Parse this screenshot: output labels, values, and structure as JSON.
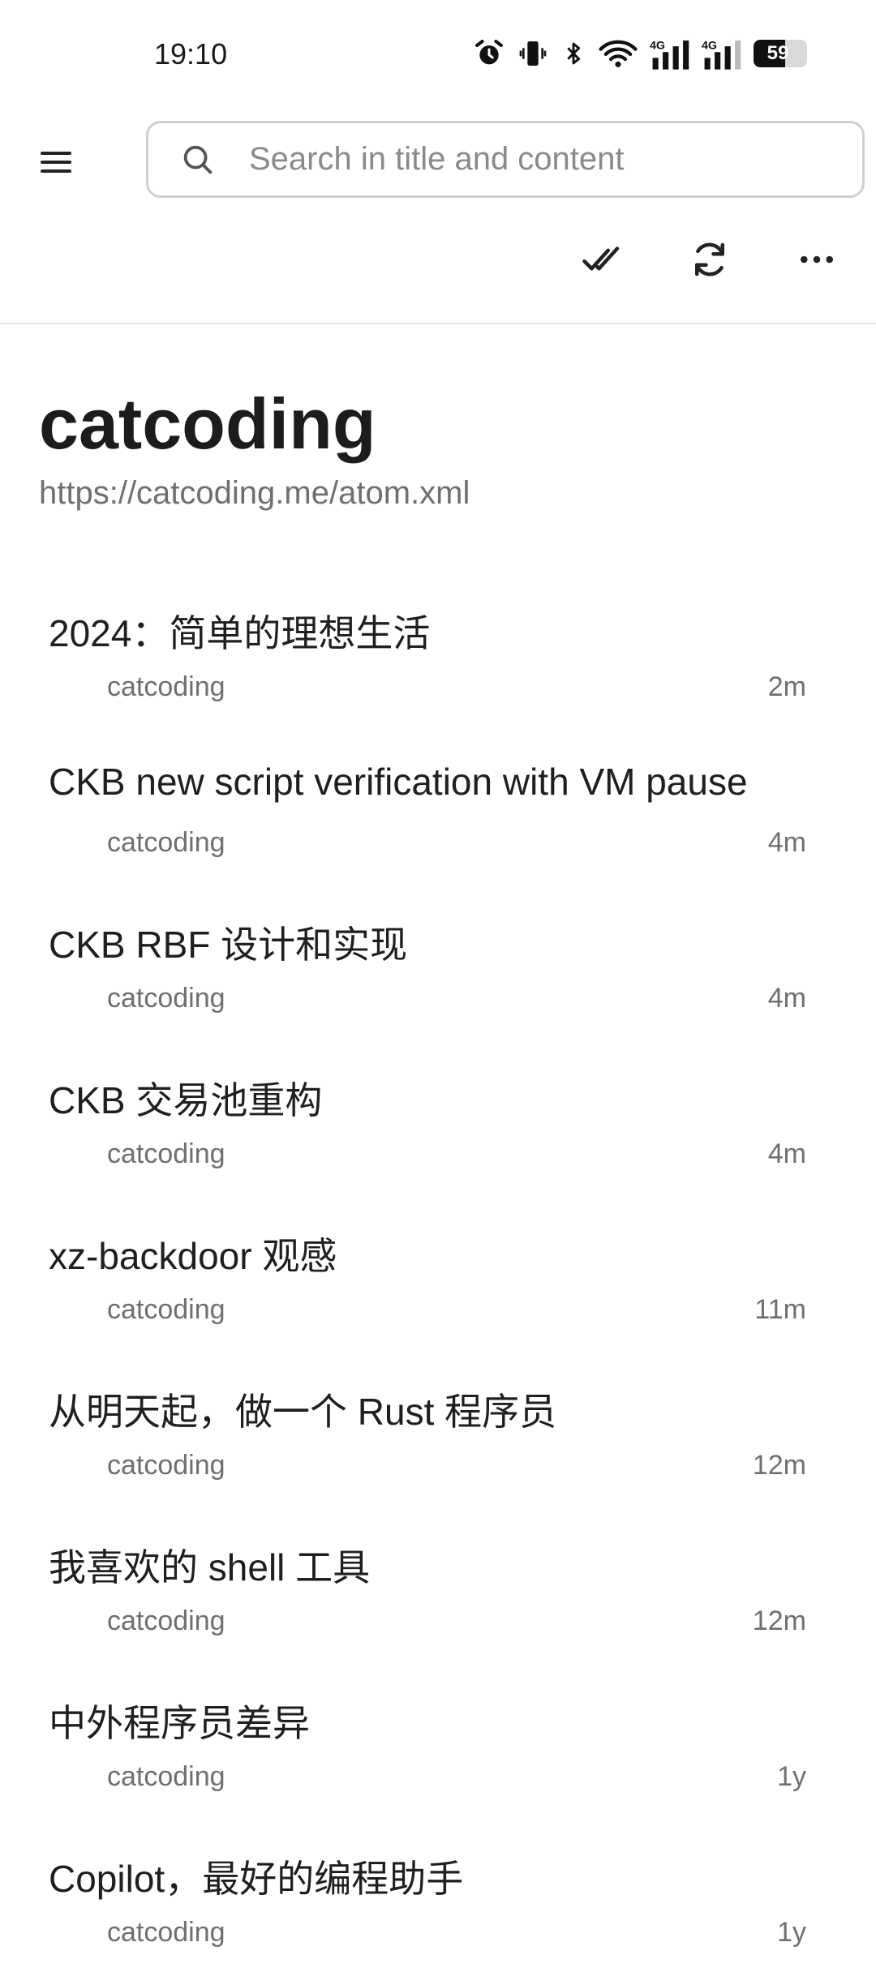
{
  "status": {
    "time": "19:10",
    "battery": "59",
    "battery_level": 0.59
  },
  "search": {
    "placeholder": "Search in title and content"
  },
  "feed": {
    "title": "catcoding",
    "url": "https://catcoding.me/atom.xml"
  },
  "articles": [
    {
      "title": "2024：简单的理想生活",
      "author": "catcoding",
      "time": "2m"
    },
    {
      "title": "CKB new script verification with VM pause",
      "author": "catcoding",
      "time": "4m"
    },
    {
      "title": "CKB RBF 设计和实现",
      "author": "catcoding",
      "time": "4m"
    },
    {
      "title": "CKB 交易池重构",
      "author": "catcoding",
      "time": "4m"
    },
    {
      "title": "xz-backdoor 观感",
      "author": "catcoding",
      "time": "11m"
    },
    {
      "title": "从明天起，做一个 Rust 程序员",
      "author": "catcoding",
      "time": "12m"
    },
    {
      "title": "我喜欢的 shell 工具",
      "author": "catcoding",
      "time": "12m"
    },
    {
      "title": "中外程序员差异",
      "author": "catcoding",
      "time": "1y"
    },
    {
      "title": "Copilot，最好的编程助手",
      "author": "catcoding",
      "time": "1y"
    }
  ],
  "icons": {
    "menu": "hamburger-menu-icon",
    "search": "search-icon",
    "mark_all_read": "double-check-icon",
    "refresh": "refresh-icon",
    "more": "more-horizontal-icon"
  }
}
